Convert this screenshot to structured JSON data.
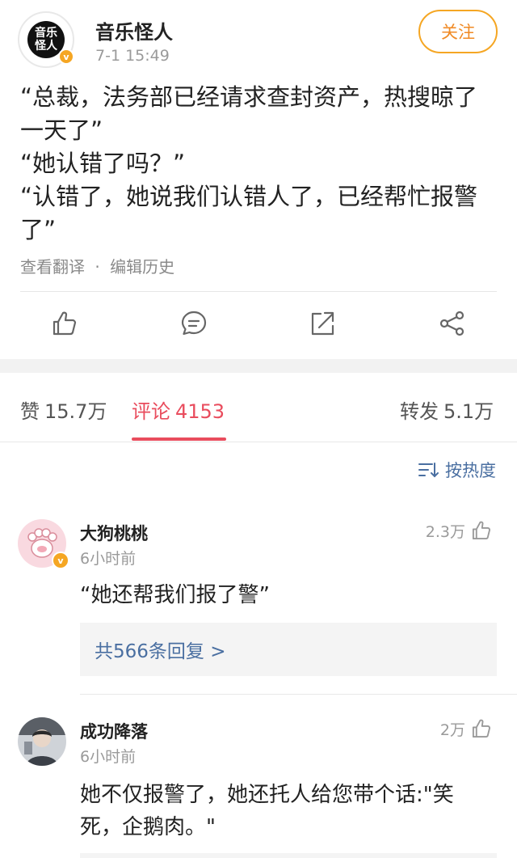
{
  "post": {
    "author": "音乐怪人",
    "avatar_text_line1": "音乐",
    "avatar_text_line2": "怪人",
    "verified_mark": "v",
    "time": "7-1 15:49",
    "follow_label": "关注",
    "lines": [
      "“总裁，法务部已经请求查封资产，热搜晾了",
      "一天了”",
      "“她认错了吗？”",
      "“认错了，她说我们认错人了，已经帮忙报警",
      "了”"
    ],
    "meta_translate": "查看翻译",
    "meta_sep": "·",
    "meta_history": "编辑历史"
  },
  "actions": {
    "icons": [
      "like-icon",
      "comment-icon",
      "repost-icon",
      "share-icon"
    ]
  },
  "tabs": {
    "likes_label": "赞",
    "likes_count": "15.7万",
    "comments_label": "评论",
    "comments_count": "4153",
    "reposts_label": "转发",
    "reposts_count": "5.1万"
  },
  "sort": {
    "label": "按热度",
    "icon": "sort-icon"
  },
  "comments": [
    {
      "name": "大狗桃桃",
      "time": "6小时前",
      "likes": "2.3万",
      "text": "“她还帮我们报了警”",
      "replies": "共566条回复 >",
      "verified": true
    },
    {
      "name": "成功降落",
      "time": "6小时前",
      "likes": "2万",
      "text_line1": "她不仅报警了，她还托人给您带个话:\"笑",
      "text_line2": "死，企鹅肉。\"",
      "verified": false
    }
  ],
  "colors": {
    "accent_orange": "#f08a24",
    "tab_active_red": "#e94c5d",
    "link_blue": "#4a6fa1",
    "muted_gray": "#9a9a9a"
  }
}
